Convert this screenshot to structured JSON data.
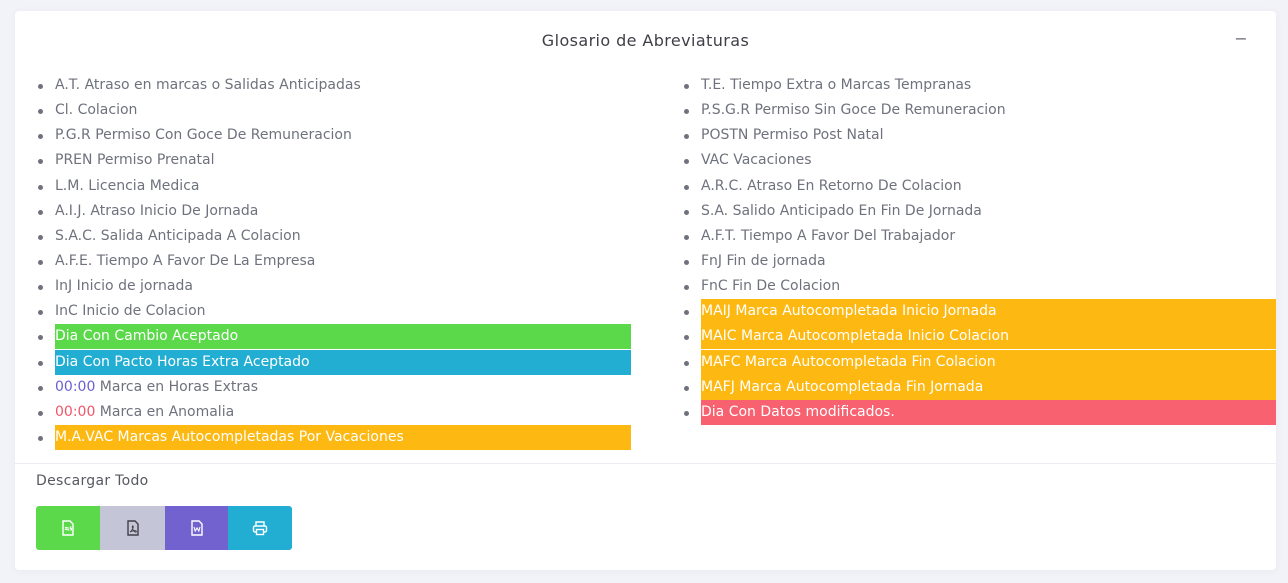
{
  "panel": {
    "title": "Glosario de Abreviaturas",
    "collapse_label": "−"
  },
  "left_items": [
    {
      "text": "A.T. Atraso en marcas o Salidas Anticipadas"
    },
    {
      "text": "Cl. Colacion"
    },
    {
      "text": "P.G.R Permiso Con Goce De Remuneracion"
    },
    {
      "text": "PREN Permiso Prenatal"
    },
    {
      "text": "L.M. Licencia Medica"
    },
    {
      "text": "A.I.J. Atraso Inicio De Jornada"
    },
    {
      "text": "S.A.C. Salida Anticipada A Colacion"
    },
    {
      "text": "A.F.E. Tiempo A Favor De La Empresa"
    },
    {
      "text": "InJ Inicio de jornada"
    },
    {
      "text": "InC Inicio de Colacion"
    },
    {
      "text": "Dia Con Cambio Aceptado",
      "highlight": "#5bd94a"
    },
    {
      "text": "Dia Con Pacto Horas Extra Aceptado",
      "highlight": "#22aed3"
    },
    {
      "time": "00:00",
      "time_color": "#6a5fd0",
      "text": " Marca en Horas Extras"
    },
    {
      "time": "00:00",
      "time_color": "#f0566a",
      "text": " Marca en Anomalia"
    },
    {
      "text": "M.A.VAC Marcas Autocompletadas Por Vacaciones",
      "highlight": "#fdb811"
    }
  ],
  "right_items": [
    {
      "text": "T.E. Tiempo Extra o Marcas Tempranas"
    },
    {
      "text": "P.S.G.R Permiso Sin Goce De Remuneracion"
    },
    {
      "text": "POSTN Permiso Post Natal"
    },
    {
      "text": "VAC Vacaciones"
    },
    {
      "text": "A.R.C. Atraso En Retorno De Colacion"
    },
    {
      "text": "S.A. Salido Anticipado En Fin De Jornada"
    },
    {
      "text": "A.F.T. Tiempo A Favor Del Trabajador"
    },
    {
      "text": "FnJ Fin de jornada"
    },
    {
      "text": "FnC Fin De Colacion"
    },
    {
      "text": "MAIJ Marca Autocompletada Inicio Jornada",
      "highlight": "#fdb811"
    },
    {
      "text": "MAIC Marca Autocompletada Inicio Colacion",
      "highlight": "#fdb811"
    },
    {
      "text": "MAFC Marca Autocompletada Fin Colacion",
      "highlight": "#fdb811"
    },
    {
      "text": "MAFJ Marca Autocompletada Fin Jornada",
      "highlight": "#fdb811"
    },
    {
      "text": "Dia Con Datos modificados.",
      "highlight": "#f8616f"
    }
  ],
  "download": {
    "label": "Descargar Todo",
    "buttons": [
      {
        "icon": "excel-file-icon",
        "color": "#5bd94a"
      },
      {
        "icon": "pdf-file-icon",
        "color": "#c4c5d6"
      },
      {
        "icon": "word-file-icon",
        "color": "#7162cf"
      },
      {
        "icon": "print-icon",
        "color": "#22aed3"
      }
    ]
  }
}
